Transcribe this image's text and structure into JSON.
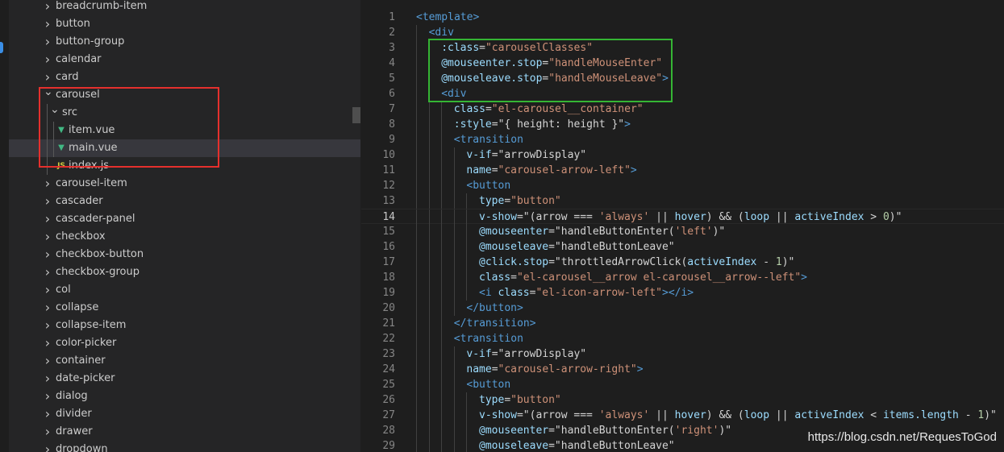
{
  "explorer": {
    "items": [
      {
        "label": "breadcrumb-item",
        "type": "folder",
        "level": 0,
        "expanded": false
      },
      {
        "label": "button",
        "type": "folder",
        "level": 0,
        "expanded": false
      },
      {
        "label": "button-group",
        "type": "folder",
        "level": 0,
        "expanded": false
      },
      {
        "label": "calendar",
        "type": "folder",
        "level": 0,
        "expanded": false
      },
      {
        "label": "card",
        "type": "folder",
        "level": 0,
        "expanded": false
      },
      {
        "label": "carousel",
        "type": "folder",
        "level": 0,
        "expanded": true
      },
      {
        "label": "src",
        "type": "folder",
        "level": 1,
        "expanded": true
      },
      {
        "label": "item.vue",
        "type": "vue",
        "level": 2
      },
      {
        "label": "main.vue",
        "type": "vue",
        "level": 2,
        "selected": true
      },
      {
        "label": "index.js",
        "type": "js",
        "level": 1
      },
      {
        "label": "carousel-item",
        "type": "folder",
        "level": 0,
        "expanded": false
      },
      {
        "label": "cascader",
        "type": "folder",
        "level": 0,
        "expanded": false
      },
      {
        "label": "cascader-panel",
        "type": "folder",
        "level": 0,
        "expanded": false
      },
      {
        "label": "checkbox",
        "type": "folder",
        "level": 0,
        "expanded": false
      },
      {
        "label": "checkbox-button",
        "type": "folder",
        "level": 0,
        "expanded": false
      },
      {
        "label": "checkbox-group",
        "type": "folder",
        "level": 0,
        "expanded": false
      },
      {
        "label": "col",
        "type": "folder",
        "level": 0,
        "expanded": false
      },
      {
        "label": "collapse",
        "type": "folder",
        "level": 0,
        "expanded": false
      },
      {
        "label": "collapse-item",
        "type": "folder",
        "level": 0,
        "expanded": false
      },
      {
        "label": "color-picker",
        "type": "folder",
        "level": 0,
        "expanded": false
      },
      {
        "label": "container",
        "type": "folder",
        "level": 0,
        "expanded": false
      },
      {
        "label": "date-picker",
        "type": "folder",
        "level": 0,
        "expanded": false
      },
      {
        "label": "dialog",
        "type": "folder",
        "level": 0,
        "expanded": false
      },
      {
        "label": "divider",
        "type": "folder",
        "level": 0,
        "expanded": false
      },
      {
        "label": "drawer",
        "type": "folder",
        "level": 0,
        "expanded": false
      },
      {
        "label": "dropdown",
        "type": "folder",
        "level": 0,
        "expanded": false
      }
    ]
  },
  "editor": {
    "current_line": 14,
    "lines": [
      {
        "n": "1",
        "indent": 0,
        "tokens": [
          [
            "tag",
            "<template>"
          ]
        ]
      },
      {
        "n": "2",
        "indent": 1,
        "tokens": [
          [
            "tag",
            "<div"
          ]
        ]
      },
      {
        "n": "3",
        "indent": 2,
        "tokens": [
          [
            "attr",
            ":class"
          ],
          [
            "plain",
            "="
          ],
          [
            "str",
            "\"carouselClasses\""
          ]
        ]
      },
      {
        "n": "4",
        "indent": 2,
        "tokens": [
          [
            "attr",
            "@mouseenter.stop"
          ],
          [
            "plain",
            "="
          ],
          [
            "str",
            "\"handleMouseEnter\""
          ]
        ]
      },
      {
        "n": "5",
        "indent": 2,
        "tokens": [
          [
            "attr",
            "@mouseleave.stop"
          ],
          [
            "plain",
            "="
          ],
          [
            "str",
            "\"handleMouseLeave\""
          ],
          [
            "tag",
            ">"
          ]
        ]
      },
      {
        "n": "6",
        "indent": 2,
        "tokens": [
          [
            "tag",
            "<div"
          ]
        ]
      },
      {
        "n": "7",
        "indent": 3,
        "tokens": [
          [
            "attr",
            "class"
          ],
          [
            "plain",
            "="
          ],
          [
            "str",
            "\"el-carousel__container\""
          ]
        ]
      },
      {
        "n": "8",
        "indent": 3,
        "tokens": [
          [
            "attr",
            ":style"
          ],
          [
            "plain",
            "=\"{ height: height }\""
          ],
          [
            "tag",
            ">"
          ]
        ]
      },
      {
        "n": "9",
        "indent": 3,
        "tokens": [
          [
            "tag",
            "<transition"
          ]
        ]
      },
      {
        "n": "10",
        "indent": 4,
        "tokens": [
          [
            "attr",
            "v-if"
          ],
          [
            "plain",
            "=\"arrowDisplay\""
          ]
        ]
      },
      {
        "n": "11",
        "indent": 4,
        "tokens": [
          [
            "attr",
            "name"
          ],
          [
            "plain",
            "="
          ],
          [
            "str",
            "\"carousel-arrow-left\""
          ],
          [
            "tag",
            ">"
          ]
        ]
      },
      {
        "n": "12",
        "indent": 4,
        "tokens": [
          [
            "tag",
            "<button"
          ]
        ]
      },
      {
        "n": "13",
        "indent": 5,
        "tokens": [
          [
            "attr",
            "type"
          ],
          [
            "plain",
            "="
          ],
          [
            "str",
            "\"button\""
          ]
        ]
      },
      {
        "n": "14",
        "indent": 5,
        "tokens": [
          [
            "attr",
            "v-show"
          ],
          [
            "plain",
            "=\"(arrow === "
          ],
          [
            "str",
            "'always'"
          ],
          [
            "plain",
            " || "
          ],
          [
            "attr",
            "hover"
          ],
          [
            "plain",
            ") && ("
          ],
          [
            "attr",
            "loop"
          ],
          [
            "plain",
            " || "
          ],
          [
            "attr",
            "activeIndex"
          ],
          [
            "plain",
            " > "
          ],
          [
            "num",
            "0"
          ],
          [
            "plain",
            ")\""
          ]
        ]
      },
      {
        "n": "15",
        "indent": 5,
        "tokens": [
          [
            "attr",
            "@mouseenter"
          ],
          [
            "plain",
            "=\""
          ],
          [
            "plain",
            "handleButtonEnter("
          ],
          [
            "str",
            "'left'"
          ],
          [
            "plain",
            ")\""
          ]
        ]
      },
      {
        "n": "16",
        "indent": 5,
        "tokens": [
          [
            "attr",
            "@mouseleave"
          ],
          [
            "plain",
            "=\"handleButtonLeave\""
          ]
        ]
      },
      {
        "n": "17",
        "indent": 5,
        "tokens": [
          [
            "attr",
            "@click.stop"
          ],
          [
            "plain",
            "=\"throttledArrowClick("
          ],
          [
            "attr",
            "activeIndex"
          ],
          [
            "plain",
            " - "
          ],
          [
            "num",
            "1"
          ],
          [
            "plain",
            ")\""
          ]
        ]
      },
      {
        "n": "18",
        "indent": 5,
        "tokens": [
          [
            "attr",
            "class"
          ],
          [
            "plain",
            "="
          ],
          [
            "str",
            "\"el-carousel__arrow el-carousel__arrow--left\""
          ],
          [
            "tag",
            ">"
          ]
        ]
      },
      {
        "n": "19",
        "indent": 5,
        "tokens": [
          [
            "tag",
            "<i "
          ],
          [
            "attr",
            "class"
          ],
          [
            "plain",
            "="
          ],
          [
            "str",
            "\"el-icon-arrow-left\""
          ],
          [
            "tag",
            "></i>"
          ]
        ]
      },
      {
        "n": "20",
        "indent": 4,
        "tokens": [
          [
            "tag",
            "</button>"
          ]
        ]
      },
      {
        "n": "21",
        "indent": 3,
        "tokens": [
          [
            "tag",
            "</transition>"
          ]
        ]
      },
      {
        "n": "22",
        "indent": 3,
        "tokens": [
          [
            "tag",
            "<transition"
          ]
        ]
      },
      {
        "n": "23",
        "indent": 4,
        "tokens": [
          [
            "attr",
            "v-if"
          ],
          [
            "plain",
            "=\"arrowDisplay\""
          ]
        ]
      },
      {
        "n": "24",
        "indent": 4,
        "tokens": [
          [
            "attr",
            "name"
          ],
          [
            "plain",
            "="
          ],
          [
            "str",
            "\"carousel-arrow-right\""
          ],
          [
            "tag",
            ">"
          ]
        ]
      },
      {
        "n": "25",
        "indent": 4,
        "tokens": [
          [
            "tag",
            "<button"
          ]
        ]
      },
      {
        "n": "26",
        "indent": 5,
        "tokens": [
          [
            "attr",
            "type"
          ],
          [
            "plain",
            "="
          ],
          [
            "str",
            "\"button\""
          ]
        ]
      },
      {
        "n": "27",
        "indent": 5,
        "tokens": [
          [
            "attr",
            "v-show"
          ],
          [
            "plain",
            "=\"(arrow === "
          ],
          [
            "str",
            "'always'"
          ],
          [
            "plain",
            " || "
          ],
          [
            "attr",
            "hover"
          ],
          [
            "plain",
            ") && ("
          ],
          [
            "attr",
            "loop"
          ],
          [
            "plain",
            " || "
          ],
          [
            "attr",
            "activeIndex"
          ],
          [
            "plain",
            " < "
          ],
          [
            "attr",
            "items.length"
          ],
          [
            "plain",
            " - "
          ],
          [
            "num",
            "1"
          ],
          [
            "plain",
            ")\""
          ]
        ]
      },
      {
        "n": "28",
        "indent": 5,
        "tokens": [
          [
            "attr",
            "@mouseenter"
          ],
          [
            "plain",
            "=\"handleButtonEnter("
          ],
          [
            "str",
            "'right'"
          ],
          [
            "plain",
            ")\""
          ]
        ]
      },
      {
        "n": "29",
        "indent": 5,
        "tokens": [
          [
            "attr",
            "@mouseleave"
          ],
          [
            "plain",
            "=\"handleButtonLeave\""
          ]
        ]
      }
    ]
  },
  "watermark": "https://blog.csdn.net/RequesToGod",
  "colors": {
    "highlight_red": "#e5302d",
    "highlight_green": "#35b534",
    "vue_icon": "#41b883",
    "js_icon": "#cbcb41"
  }
}
